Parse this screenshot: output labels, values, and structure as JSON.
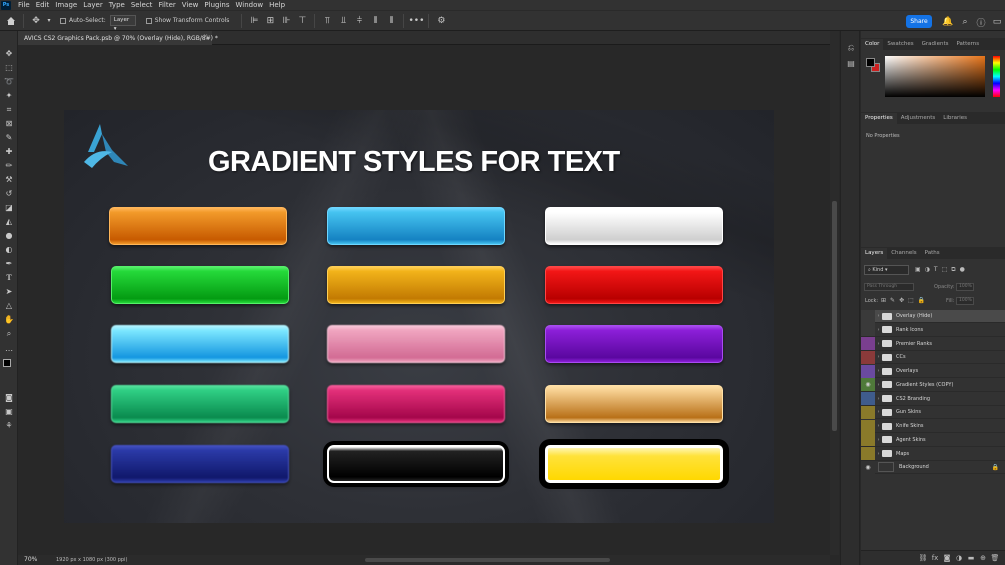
{
  "menu": [
    "File",
    "Edit",
    "Image",
    "Layer",
    "Type",
    "Select",
    "Filter",
    "View",
    "Plugins",
    "Window",
    "Help"
  ],
  "options_bar": {
    "auto_select_label": "Auto-Select:",
    "layer_select_value": "Layer",
    "show_transform_label": "Show Transform Controls",
    "share_label": "Share"
  },
  "document": {
    "tab_title": "AVICS CS2 Graphics Pack.psb @ 70% (Overlay (Hide), RGB/8#) *",
    "close_glyph": "×",
    "zoom": "70%",
    "info": "1920 px x 1080 px (300 ppi)"
  },
  "artboard": {
    "title": "GRADIENT STYLES FOR TEXT",
    "swatches": [
      {
        "name": "orange",
        "top": "#f29a2a",
        "bottom": "#c75a00",
        "border": "#ffb65a"
      },
      {
        "name": "sky-blue",
        "top": "#45c3f0",
        "bottom": "#1582c2",
        "border": "#6ed6ff"
      },
      {
        "name": "white",
        "top": "#ffffff",
        "bottom": "#cfcfcf",
        "border": "#ffffff"
      },
      {
        "name": "green",
        "top": "#25d93a",
        "bottom": "#049b12",
        "border": "#56f06a"
      },
      {
        "name": "gold",
        "top": "#f2b31a",
        "bottom": "#c27a02",
        "border": "#ffcf55"
      },
      {
        "name": "red",
        "top": "#f21616",
        "bottom": "#b80000",
        "border": "#ff4545"
      },
      {
        "name": "cyan-glow",
        "top": "#7de8ff",
        "bottom": "#1496e0",
        "border": "#b4f3ff"
      },
      {
        "name": "pink",
        "top": "#f0a5c0",
        "bottom": "#d26b94",
        "border": "#f8c6d8"
      },
      {
        "name": "purple",
        "top": "#8c1fd8",
        "bottom": "#5a079f",
        "border": "#a84cf0"
      },
      {
        "name": "emerald",
        "top": "#2fcf84",
        "bottom": "#0a8a4e",
        "border": "#54e09c"
      },
      {
        "name": "magenta",
        "top": "#e3307a",
        "bottom": "#a4064a",
        "border": "#f45a98"
      },
      {
        "name": "bronze",
        "top": "#f7d193",
        "bottom": "#b87018",
        "border": "#ffe0a6"
      },
      {
        "name": "navy",
        "top": "#2b3aa8",
        "bottom": "#10186b",
        "border": "#4350c0"
      },
      {
        "name": "black-chrome",
        "top": "#222222",
        "bottom": "#000000",
        "border": "#ffffff"
      },
      {
        "name": "yellow",
        "top": "#ffe23a",
        "bottom": "#f2c400",
        "border": "#ffffff"
      }
    ]
  },
  "panels": {
    "color_tabs": [
      "Color",
      "Swatches",
      "Gradients",
      "Patterns"
    ],
    "foreground": "#000000",
    "background": "#cc1f1f",
    "properties_tabs": [
      "Properties",
      "Adjustments",
      "Libraries"
    ],
    "no_properties": "No Properties",
    "layers_tabs": [
      "Layers",
      "Channels",
      "Paths"
    ],
    "kind_label": "Kind",
    "blend_mode": "Pass Through",
    "opacity_label": "Opacity:",
    "opacity_value": "100%",
    "lock_label": "Lock:",
    "fill_label": "Fill:",
    "fill_value": "100%",
    "layers": [
      {
        "name": "Overlay (Hide)",
        "color": "#3a3a3a",
        "visible": false,
        "selected": true
      },
      {
        "name": "Rank Icons",
        "color": "#3a3a3a",
        "visible": false,
        "selected": false
      },
      {
        "name": "Premier Ranks",
        "color": "#7a3f8f",
        "visible": false,
        "selected": false
      },
      {
        "name": "CCs",
        "color": "#8a3a3a",
        "visible": false,
        "selected": false
      },
      {
        "name": "Overlays",
        "color": "#6a4aa0",
        "visible": false,
        "selected": false
      },
      {
        "name": "Gradient Styles (COPY)",
        "color": "#4f7a3a",
        "visible": true,
        "selected": false
      },
      {
        "name": "CS2 Branding",
        "color": "#3f5c8c",
        "visible": false,
        "selected": false
      },
      {
        "name": "Gun Skins",
        "color": "#8a7a2a",
        "visible": false,
        "selected": false
      },
      {
        "name": "Knife Skins",
        "color": "#8a7a2a",
        "visible": false,
        "selected": false
      },
      {
        "name": "Agent Skins",
        "color": "#8a7a2a",
        "visible": false,
        "selected": false
      },
      {
        "name": "Maps",
        "color": "#8a7a2a",
        "visible": false,
        "selected": false
      },
      {
        "name": "Background",
        "color": "#323232",
        "visible": true,
        "selected": false
      }
    ]
  }
}
